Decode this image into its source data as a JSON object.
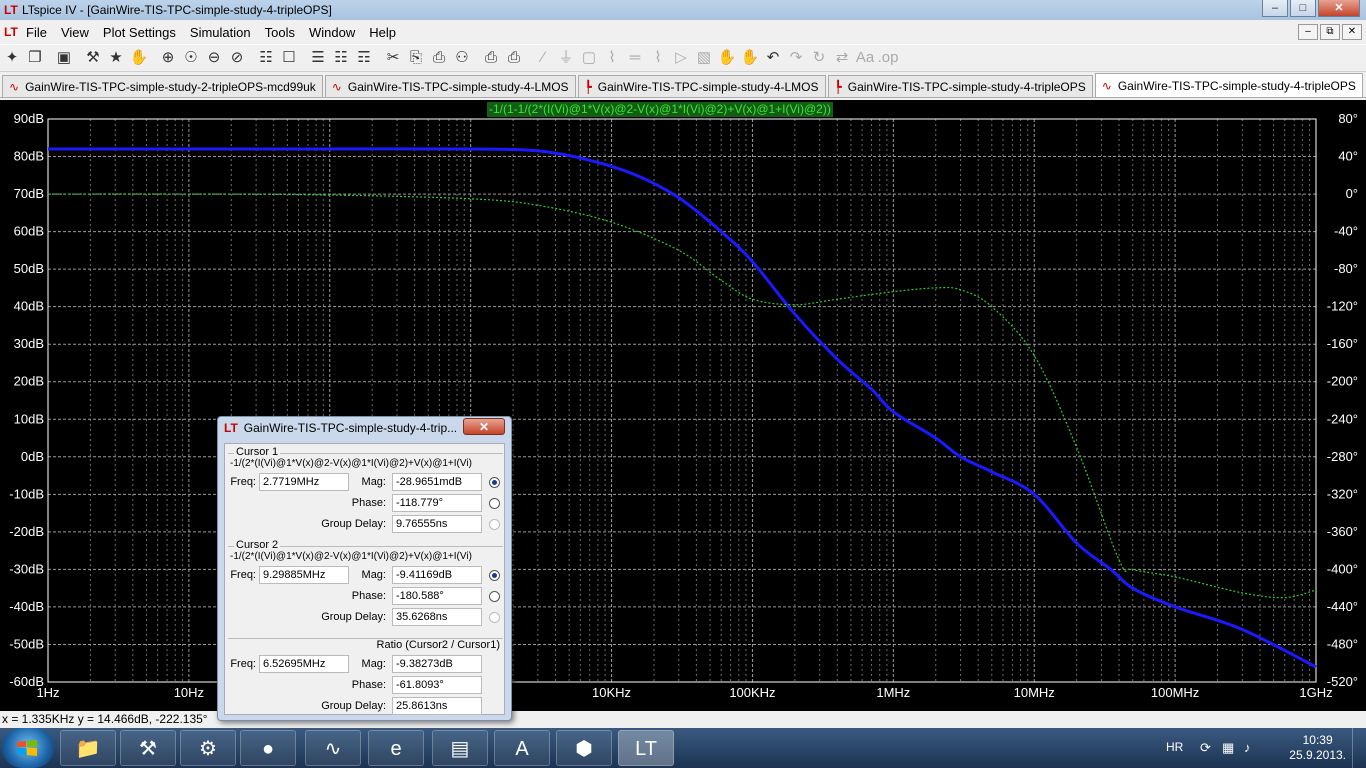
{
  "window": {
    "title": "LTspice IV - [GainWire-TIS-TPC-simple-study-4-tripleOPS]",
    "app_glyph": "LT",
    "min": "–",
    "max": "□",
    "close": "✕"
  },
  "menu": [
    "File",
    "View",
    "Plot Settings",
    "Simulation",
    "Tools",
    "Window",
    "Help"
  ],
  "mdi": {
    "min": "–",
    "restore": "⧉",
    "close": "✕"
  },
  "toolbar": [
    {
      "name": "new-schematic-icon",
      "glyph": "✦"
    },
    {
      "name": "open-icon",
      "glyph": "❐"
    },
    {
      "sep": true
    },
    {
      "name": "save-icon",
      "glyph": "▣"
    },
    {
      "sep": true
    },
    {
      "name": "control-panel-icon",
      "glyph": "⚒"
    },
    {
      "name": "run-icon",
      "glyph": "★"
    },
    {
      "name": "pan-icon",
      "glyph": "✋"
    },
    {
      "sep": true
    },
    {
      "name": "zoom-in-icon",
      "glyph": "⊕"
    },
    {
      "name": "zoom-rect-icon",
      "glyph": "☉"
    },
    {
      "name": "zoom-out-icon",
      "glyph": "⊖"
    },
    {
      "name": "zoom-cancel-icon",
      "glyph": "⊘"
    },
    {
      "sep": true
    },
    {
      "name": "autorange-icon",
      "glyph": "☷"
    },
    {
      "name": "fit-icon",
      "glyph": "☐"
    },
    {
      "sep": true
    },
    {
      "name": "tile-horizontal-icon",
      "glyph": "☰"
    },
    {
      "name": "cascade-icon",
      "glyph": "☷"
    },
    {
      "name": "tile-vertical-icon",
      "glyph": "☶"
    },
    {
      "sep": true
    },
    {
      "name": "cut-icon",
      "glyph": "✂"
    },
    {
      "name": "copy-icon",
      "glyph": "⎘"
    },
    {
      "name": "paste-icon",
      "glyph": "⎙"
    },
    {
      "name": "find-icon",
      "glyph": "⚇"
    },
    {
      "sep": true
    },
    {
      "name": "print-preview-icon",
      "glyph": "⎙"
    },
    {
      "name": "print-icon",
      "glyph": "⎙"
    },
    {
      "sep": true
    },
    {
      "name": "wire-icon",
      "glyph": "∕",
      "dis": true
    },
    {
      "name": "ground-icon",
      "glyph": "⏚",
      "dis": true
    },
    {
      "name": "label-icon",
      "glyph": "▢",
      "dis": true
    },
    {
      "name": "resistor-icon",
      "glyph": "⌇",
      "dis": true
    },
    {
      "name": "capacitor-icon",
      "glyph": "═",
      "dis": true
    },
    {
      "name": "inductor-icon",
      "glyph": "⌇",
      "dis": true
    },
    {
      "name": "diode-icon",
      "glyph": "▷",
      "dis": true
    },
    {
      "name": "component-icon",
      "glyph": "▧",
      "dis": true
    },
    {
      "name": "move-icon",
      "glyph": "✋",
      "dis": true
    },
    {
      "name": "drag-icon",
      "glyph": "✋",
      "dis": true
    },
    {
      "name": "undo-icon",
      "glyph": "↶"
    },
    {
      "name": "redo-icon",
      "glyph": "↷",
      "dis": true
    },
    {
      "name": "rotate-icon",
      "glyph": "↻",
      "dis": true
    },
    {
      "name": "mirror-icon",
      "glyph": "⇄",
      "dis": true
    },
    {
      "name": "text-icon",
      "glyph": "Aa",
      "dis": true
    },
    {
      "name": "spice-directive-icon",
      "glyph": ".op",
      "dis": true
    }
  ],
  "tabs": [
    {
      "label": "GainWire-TIS-TPC-simple-study-2-tripleOPS-mcd99uk",
      "icon": "waveform-icon",
      "glyph": "∿"
    },
    {
      "label": "GainWire-TIS-TPC-simple-study-4-LMOS",
      "icon": "waveform-icon",
      "glyph": "∿"
    },
    {
      "label": "GainWire-TIS-TPC-simple-study-4-LMOS",
      "icon": "schematic-icon",
      "glyph": "┡"
    },
    {
      "label": "GainWire-TIS-TPC-simple-study-4-tripleOPS",
      "icon": "schematic-icon",
      "glyph": "┡"
    },
    {
      "label": "GainWire-TIS-TPC-simple-study-4-tripleOPS",
      "icon": "waveform-icon",
      "glyph": "∿",
      "active": true
    }
  ],
  "plot": {
    "trace_expression": "-1/(1-1/(2*(I(Vi)@1*V(x)@2-V(x)@1*I(Vi)@2)+V(x)@1+I(Vi)@2))",
    "colors": {
      "background": "#000000",
      "grid": "#9a9a9a",
      "magnitude": "#1a1aff",
      "phase": "#2ecc2e",
      "labels": "#ffffff",
      "expression_bg": "#145d14",
      "expression_text": "#39e639"
    }
  },
  "chart_data": {
    "type": "line",
    "title": "-1/(1-1/(2*(I(Vi)@1*V(x)@2-V(x)@1*I(Vi)@2)+V(x)@1+I(Vi)@2))",
    "x_scale": "log",
    "xlim": [
      1,
      1000000000
    ],
    "x_tick_labels": [
      "1Hz",
      "10Hz",
      "100Hz",
      "1KHz",
      "10KHz",
      "100KHz",
      "1MHz",
      "10MHz",
      "100MHz",
      "1GHz"
    ],
    "ylim_left": [
      -60,
      90
    ],
    "y_tick_labels_left": [
      "90dB",
      "80dB",
      "70dB",
      "60dB",
      "50dB",
      "40dB",
      "30dB",
      "20dB",
      "10dB",
      "0dB",
      "-10dB",
      "-20dB",
      "-30dB",
      "-40dB",
      "-50dB",
      "-60dB"
    ],
    "ylim_right": [
      -520,
      80
    ],
    "y_tick_labels_right": [
      "80°",
      "40°",
      "0°",
      "-40°",
      "-80°",
      "-120°",
      "-160°",
      "-200°",
      "-240°",
      "-280°",
      "-320°",
      "-360°",
      "-400°",
      "-440°",
      "-480°",
      "-520°"
    ],
    "grid": true,
    "series": [
      {
        "axis": "left",
        "style": "solid",
        "x": [
          1,
          10,
          100,
          1000,
          3000,
          7000,
          15000,
          30000,
          60000,
          100000,
          200000,
          400000,
          700000,
          1000000,
          2000000,
          3000000,
          5000000,
          10000000,
          20000000,
          35000000,
          50000000,
          100000000,
          300000000,
          1000000000
        ],
        "y": [
          82,
          82,
          82,
          82,
          81.5,
          79,
          75,
          69,
          60,
          52,
          38,
          26,
          18,
          12,
          5,
          0,
          -4,
          -10,
          -23,
          -30,
          -35,
          -40,
          -46,
          -56
        ]
      },
      {
        "axis": "right",
        "style": "dotted",
        "x": [
          1,
          10,
          100,
          1000,
          3000,
          10000,
          30000,
          60000,
          100000,
          200000,
          400000,
          1000000,
          2000000,
          3000000,
          5000000,
          10000000,
          20000000,
          40000000,
          50000000,
          100000000,
          300000000,
          600000000,
          1000000000
        ],
        "y": [
          0,
          0,
          -1,
          -5,
          -12,
          -30,
          -60,
          -92,
          -112,
          -118,
          -112,
          -104,
          -100,
          -102,
          -120,
          -172,
          -270,
          -390,
          -400,
          -408,
          -425,
          -430,
          -422
        ]
      }
    ]
  },
  "status": "x = 1.335KHz   y = 14.466dB, -222.135°",
  "dialog": {
    "title": "GainWire-TIS-TPC-simple-study-4-trip...",
    "close": "✕",
    "labels": {
      "freq": "Freq:",
      "mag": "Mag:",
      "phase": "Phase:",
      "group_delay": "Group Delay:"
    },
    "cursor1": {
      "heading": "Cursor 1",
      "expr": "-1/(2*(I(Vi)@1*V(x)@2-V(x)@1*I(Vi)@2)+V(x)@1+I(Vi)",
      "freq": "2.7719MHz",
      "mag": "-28.9651mdB",
      "phase": "-118.779°",
      "group_delay": "9.76555ns"
    },
    "cursor2": {
      "heading": "Cursor 2",
      "expr": "-1/(2*(I(Vi)@1*V(x)@2-V(x)@1*I(Vi)@2)+V(x)@1+I(Vi)",
      "freq": "9.29885MHz",
      "mag": "-9.41169dB",
      "phase": "-180.588°",
      "group_delay": "35.6268ns"
    },
    "ratio": {
      "heading": "Ratio (Cursor2 / Cursor1)",
      "freq": "6.52695MHz",
      "mag": "-9.38273dB",
      "phase": "-61.8093°",
      "group_delay": "25.8613ns"
    }
  },
  "taskbar": {
    "apps": [
      {
        "name": "explorer-icon",
        "glyph": "📁"
      },
      {
        "name": "installer-icon",
        "glyph": "⚒"
      },
      {
        "name": "tool-icon",
        "glyph": "⚙"
      },
      {
        "name": "security-icon",
        "glyph": "●"
      },
      {
        "name": "scope-icon",
        "glyph": "∿"
      },
      {
        "name": "ie-icon",
        "glyph": "e"
      },
      {
        "name": "folder-icon",
        "glyph": "▤"
      },
      {
        "name": "word-icon",
        "glyph": "A"
      },
      {
        "name": "pdf-icon",
        "glyph": "⬢"
      },
      {
        "name": "ltspice-icon",
        "glyph": "LT",
        "active": true
      }
    ],
    "lang": "HR",
    "time": "10:39",
    "date": "25.9.2013."
  }
}
